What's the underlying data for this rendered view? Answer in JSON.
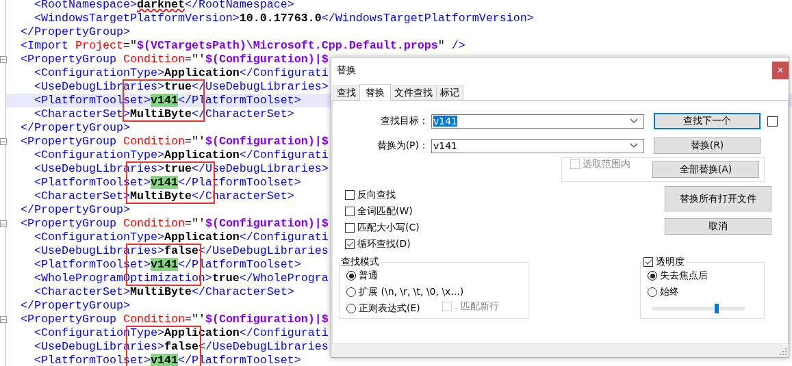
{
  "editor": {
    "lines": [
      {
        "current": false,
        "fold": false,
        "tokens": [
          {
            "kind": "tag",
            "text": "    <RootNamespace>"
          },
          {
            "kind": "spell",
            "text": "darknet"
          },
          {
            "kind": "tag",
            "text": "</RootNamespace>"
          }
        ]
      },
      {
        "current": false,
        "fold": false,
        "tokens": [
          {
            "kind": "tag",
            "text": "    <WindowsTargetPlatformVersion>"
          },
          {
            "kind": "content",
            "text": "10.0.17763.0"
          },
          {
            "kind": "tag",
            "text": "</WindowsTargetPlatformVersion>"
          }
        ]
      },
      {
        "current": false,
        "fold": false,
        "tokens": [
          {
            "kind": "tag",
            "text": "  </PropertyGroup>"
          }
        ]
      },
      {
        "current": false,
        "fold": false,
        "tokens": [
          {
            "kind": "tag",
            "text": "  <Import "
          },
          {
            "kind": "attr",
            "text": "Project"
          },
          {
            "kind": "punct",
            "text": "=\""
          },
          {
            "kind": "value",
            "text": "$(VCTargetsPath)\\Microsoft.Cpp.Default.props"
          },
          {
            "kind": "punct",
            "text": "\" "
          },
          {
            "kind": "tag",
            "text": "/>"
          }
        ]
      },
      {
        "current": false,
        "fold": true,
        "tokens": [
          {
            "kind": "tag",
            "text": "  <PropertyGroup "
          },
          {
            "kind": "attr",
            "text": "Condition"
          },
          {
            "kind": "punct",
            "text": "=\"'"
          },
          {
            "kind": "value",
            "text": "$(Configuration)|$"
          }
        ]
      },
      {
        "current": false,
        "fold": false,
        "tokens": [
          {
            "kind": "tag",
            "text": "    <ConfigurationType>"
          },
          {
            "kind": "content",
            "text": "Application"
          },
          {
            "kind": "tag",
            "text": "</Configurati"
          }
        ]
      },
      {
        "current": false,
        "fold": false,
        "tokens": [
          {
            "kind": "tag",
            "text": "    <UseDebugLibraries>"
          },
          {
            "kind": "content",
            "text": "true"
          },
          {
            "kind": "tag",
            "text": "</UseDebugLibraries>"
          }
        ]
      },
      {
        "current": true,
        "fold": false,
        "tokens": [
          {
            "kind": "tag",
            "text": "    <PlatformToolset>"
          },
          {
            "kind": "match",
            "text": "v141"
          },
          {
            "kind": "tag",
            "text": "</PlatformToolset>"
          }
        ]
      },
      {
        "current": false,
        "fold": false,
        "tokens": [
          {
            "kind": "tag",
            "text": "    <CharacterSet>"
          },
          {
            "kind": "content",
            "text": "MultiByte"
          },
          {
            "kind": "tag",
            "text": "</CharacterSet>"
          }
        ]
      },
      {
        "current": false,
        "fold": false,
        "tokens": [
          {
            "kind": "tag",
            "text": "  </PropertyGroup>"
          }
        ]
      },
      {
        "current": false,
        "fold": true,
        "tokens": [
          {
            "kind": "tag",
            "text": "  <PropertyGroup "
          },
          {
            "kind": "attr",
            "text": "Condition"
          },
          {
            "kind": "punct",
            "text": "=\"'"
          },
          {
            "kind": "value",
            "text": "$(Configuration)|$"
          }
        ]
      },
      {
        "current": false,
        "fold": false,
        "tokens": [
          {
            "kind": "tag",
            "text": "    <ConfigurationType>"
          },
          {
            "kind": "content",
            "text": "Application"
          },
          {
            "kind": "tag",
            "text": "</Configurati"
          }
        ]
      },
      {
        "current": false,
        "fold": false,
        "tokens": [
          {
            "kind": "tag",
            "text": "    <UseDebugLibraries>"
          },
          {
            "kind": "content",
            "text": "true"
          },
          {
            "kind": "tag",
            "text": "</UseDebugLibraries>"
          }
        ]
      },
      {
        "current": false,
        "fold": false,
        "tokens": [
          {
            "kind": "tag",
            "text": "    <PlatformToolset>"
          },
          {
            "kind": "match",
            "text": "v141"
          },
          {
            "kind": "tag",
            "text": "</PlatformToolset>"
          }
        ]
      },
      {
        "current": false,
        "fold": false,
        "tokens": [
          {
            "kind": "tag",
            "text": "    <CharacterSet>"
          },
          {
            "kind": "content",
            "text": "MultiByte"
          },
          {
            "kind": "tag",
            "text": "</CharacterSet>"
          }
        ]
      },
      {
        "current": false,
        "fold": false,
        "tokens": [
          {
            "kind": "tag",
            "text": "  </PropertyGroup>"
          }
        ]
      },
      {
        "current": false,
        "fold": true,
        "tokens": [
          {
            "kind": "tag",
            "text": "  <PropertyGroup "
          },
          {
            "kind": "attr",
            "text": "Condition"
          },
          {
            "kind": "punct",
            "text": "=\"'"
          },
          {
            "kind": "value",
            "text": "$(Configuration)|$"
          }
        ]
      },
      {
        "current": false,
        "fold": false,
        "tokens": [
          {
            "kind": "tag",
            "text": "    <ConfigurationType>"
          },
          {
            "kind": "content",
            "text": "Application"
          },
          {
            "kind": "tag",
            "text": "</Configurati"
          }
        ]
      },
      {
        "current": false,
        "fold": false,
        "tokens": [
          {
            "kind": "tag",
            "text": "    <UseDebugLibraries>"
          },
          {
            "kind": "content",
            "text": "false"
          },
          {
            "kind": "tag",
            "text": "</UseDebugLibraries"
          }
        ]
      },
      {
        "current": false,
        "fold": false,
        "tokens": [
          {
            "kind": "tag",
            "text": "    <PlatformToolset>"
          },
          {
            "kind": "match",
            "text": "v141"
          },
          {
            "kind": "tag",
            "text": "</PlatformToolset>"
          }
        ]
      },
      {
        "current": false,
        "fold": false,
        "tokens": [
          {
            "kind": "tag",
            "text": "    <WholeProgramOptimization>"
          },
          {
            "kind": "content",
            "text": "true"
          },
          {
            "kind": "tag",
            "text": "</WholeProgra"
          }
        ]
      },
      {
        "current": false,
        "fold": false,
        "tokens": [
          {
            "kind": "tag",
            "text": "    <CharacterSet>"
          },
          {
            "kind": "content",
            "text": "MultiByte"
          },
          {
            "kind": "tag",
            "text": "</CharacterSet>"
          }
        ]
      },
      {
        "current": false,
        "fold": false,
        "tokens": [
          {
            "kind": "tag",
            "text": "  </PropertyGroup>"
          }
        ]
      },
      {
        "current": false,
        "fold": true,
        "tokens": [
          {
            "kind": "tag",
            "text": "  <PropertyGroup "
          },
          {
            "kind": "attr",
            "text": "Condition"
          },
          {
            "kind": "punct",
            "text": "=\"'"
          },
          {
            "kind": "value",
            "text": "$(Configuration)|$"
          }
        ]
      },
      {
        "current": false,
        "fold": false,
        "tokens": [
          {
            "kind": "tag",
            "text": "    <ConfigurationType>"
          },
          {
            "kind": "content",
            "text": "Application"
          },
          {
            "kind": "tag",
            "text": "</Configurati"
          }
        ]
      },
      {
        "current": false,
        "fold": false,
        "tokens": [
          {
            "kind": "tag",
            "text": "    <UseDebugLibraries>"
          },
          {
            "kind": "content",
            "text": "false"
          },
          {
            "kind": "tag",
            "text": "</UseDebugLibraries"
          }
        ]
      },
      {
        "current": false,
        "fold": false,
        "tokens": [
          {
            "kind": "tag",
            "text": "    <PlatformToolset>"
          },
          {
            "kind": "match",
            "text": "v141"
          },
          {
            "kind": "tag",
            "text": "</PlatformToolset>"
          }
        ]
      }
    ]
  },
  "dialog": {
    "title": "替换",
    "close": "×",
    "tabs": [
      {
        "label": "查找",
        "selected": false
      },
      {
        "label": "替换",
        "selected": true
      },
      {
        "label": "文件查找",
        "selected": false
      },
      {
        "label": "标记",
        "selected": false
      }
    ],
    "find": {
      "label": "查找目标：",
      "value": "v141"
    },
    "replace": {
      "label": "替换为(P)：",
      "value": "v141"
    },
    "buttons": [
      {
        "label": "查找下一个",
        "focused": true
      },
      {
        "label": "替换(R)",
        "focused": false
      },
      {
        "label": "全部替换(A)",
        "focused": false
      },
      {
        "label": "替换所有打开文件",
        "focused": false
      },
      {
        "label": "取消",
        "focused": false
      }
    ],
    "side_checkbox": {
      "checked": false
    },
    "in_selection": {
      "label": "选取范围内",
      "checked": false,
      "disabled": true
    },
    "options": [
      {
        "label": "反向查找",
        "checked": false
      },
      {
        "label": "全词匹配(W)",
        "checked": false
      },
      {
        "label": "匹配大小写(C)",
        "checked": false
      },
      {
        "label": "循环查找(D)",
        "checked": true
      }
    ],
    "search_mode": {
      "title": "查找模式",
      "modes": [
        {
          "label": "普通",
          "selected": true
        },
        {
          "label": "扩展 (\\n, \\r, \\t, \\0, \\x...)",
          "selected": false
        },
        {
          "label": "正则表达式(E)",
          "selected": false
        }
      ],
      "dot_newline": {
        "label": ". 匹配新行",
        "checked": false,
        "disabled": true
      }
    },
    "transparency": {
      "label": "透明度",
      "checked": true,
      "modes": [
        {
          "label": "失去焦点后",
          "selected": true
        },
        {
          "label": "始终",
          "selected": false
        }
      ],
      "level": 0.7
    }
  }
}
